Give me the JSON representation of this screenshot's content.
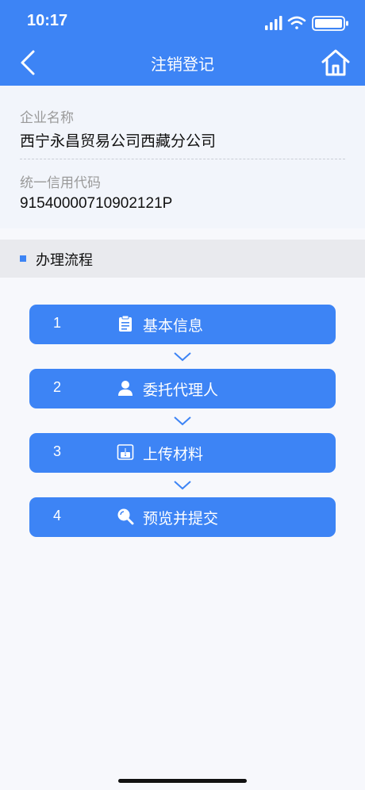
{
  "status": {
    "time": "10:17"
  },
  "nav": {
    "title": "注销登记"
  },
  "company": {
    "name_label": "企业名称",
    "name_value": "西宁永昌贸易公司西藏分公司",
    "code_label": "统一信用代码",
    "code_value": "91540000710902121P"
  },
  "section": {
    "title": "办理流程"
  },
  "steps": [
    {
      "num": "1",
      "label": "基本信息",
      "icon": "clipboard-icon"
    },
    {
      "num": "2",
      "label": "委托代理人",
      "icon": "person-icon"
    },
    {
      "num": "3",
      "label": "上传材料",
      "icon": "upload-icon"
    },
    {
      "num": "4",
      "label": "预览并提交",
      "icon": "search-icon"
    }
  ],
  "colors": {
    "accent": "#3d84f5",
    "info_bg": "#f2f5fb",
    "section_bg": "#e9eaee"
  }
}
